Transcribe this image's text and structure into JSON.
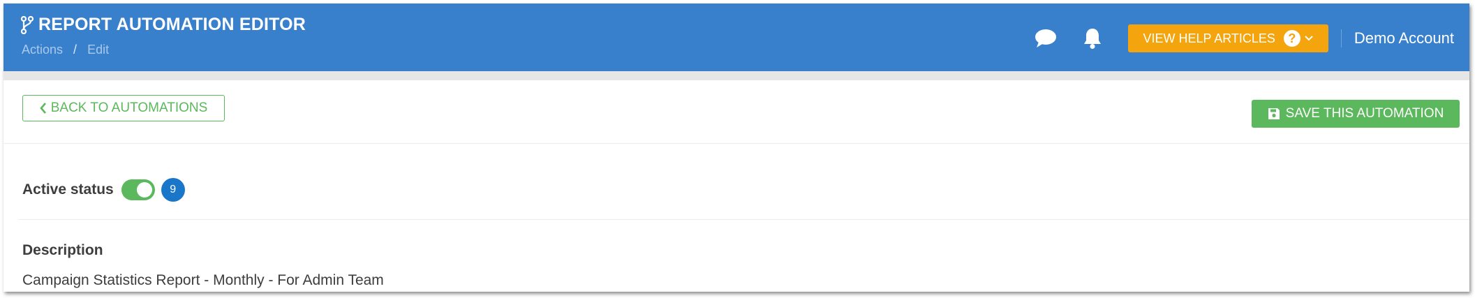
{
  "header": {
    "title": "REPORT AUTOMATION EDITOR",
    "breadcrumb": [
      "Actions",
      "Edit"
    ],
    "breadcrumb_separator": "/",
    "icons": [
      "branch-icon",
      "chat-icon",
      "bell-icon",
      "question-icon",
      "chevron-down-icon"
    ],
    "help_button_label": "VIEW HELP ARTICLES",
    "help_symbol": "?",
    "account_name": "Demo Account",
    "colors": {
      "bar": "#3980cc",
      "help": "#f4a40c"
    }
  },
  "toolbar": {
    "back_label": "BACK TO AUTOMATIONS",
    "save_label": "SAVE THIS AUTOMATION",
    "icons": [
      "chevron-left-icon",
      "floppy-disk-icon"
    ],
    "colors": {
      "primary": "#5cb85c"
    }
  },
  "status": {
    "label": "Active status",
    "active": true,
    "badge_count": "9",
    "colors": {
      "toggle": "#5cb85c",
      "badge": "#1a76c8"
    }
  },
  "description": {
    "label": "Description",
    "value": "Campaign Statistics Report - Monthly - For Admin Team"
  }
}
